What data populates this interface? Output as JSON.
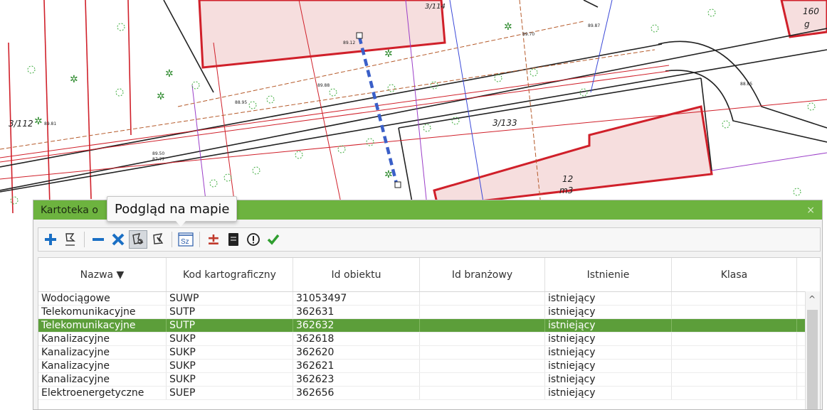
{
  "map": {
    "labels": [
      "3/114",
      "3/112",
      "3/133",
      "12",
      "m3",
      "160",
      "g"
    ],
    "heights": [
      "89.87",
      "89.70",
      "89.88",
      "88.95",
      "89.81",
      "89.50",
      "87.77",
      "89.12",
      "88.85"
    ]
  },
  "panel": {
    "title": "Kartoteka o",
    "close_label": "×"
  },
  "tooltip": {
    "text": "Podgląd na mapie"
  },
  "toolbar": {
    "buttons": [
      {
        "name": "add-icon",
        "color": "#1a6fc4"
      },
      {
        "name": "edit-geometry-icon"
      },
      {
        "name": "remove-icon",
        "color": "#1a6fc4"
      },
      {
        "name": "delete-icon",
        "color": "#1a6fc4"
      },
      {
        "name": "map-preview-icon",
        "active": true
      },
      {
        "name": "map-select-icon"
      },
      {
        "name": "sz-icon",
        "label": "Sz"
      },
      {
        "name": "plus-minus-icon",
        "label": "±",
        "color": "#c0392b"
      },
      {
        "name": "document-icon"
      },
      {
        "name": "warning-icon",
        "label": "!"
      },
      {
        "name": "confirm-icon",
        "color": "#2f9e2f"
      }
    ]
  },
  "grid": {
    "columns": [
      "Nazwa ▼",
      "Kod kartograficzny",
      "Id obiektu",
      "Id branżowy",
      "Istnienie",
      "Klasa"
    ],
    "rows": [
      {
        "nazwa": "Wodociągowe",
        "kod": "SUWP",
        "id": "31053497",
        "idb": "",
        "istnienie": "istniejący",
        "klasa": ""
      },
      {
        "nazwa": "Telekomunikacyjne",
        "kod": "SUTP",
        "id": "362631",
        "idb": "",
        "istnienie": "istniejący",
        "klasa": ""
      },
      {
        "nazwa": "Telekomunikacyjne",
        "kod": "SUTP",
        "id": "362632",
        "idb": "",
        "istnienie": "istniejący",
        "klasa": ""
      },
      {
        "nazwa": "Kanalizacyjne",
        "kod": "SUKP",
        "id": "362618",
        "idb": "",
        "istnienie": "istniejący",
        "klasa": ""
      },
      {
        "nazwa": "Kanalizacyjne",
        "kod": "SUKP",
        "id": "362620",
        "idb": "",
        "istnienie": "istniejący",
        "klasa": ""
      },
      {
        "nazwa": "Kanalizacyjne",
        "kod": "SUKP",
        "id": "362621",
        "idb": "",
        "istnienie": "istniejący",
        "klasa": ""
      },
      {
        "nazwa": "Kanalizacyjne",
        "kod": "SUKP",
        "id": "362623",
        "idb": "",
        "istnienie": "istniejący",
        "klasa": ""
      },
      {
        "nazwa": "Elektroenergetyczne",
        "kod": "SUEP",
        "id": "362656",
        "idb": "",
        "istnienie": "istniejący",
        "klasa": ""
      }
    ],
    "selected_row": 2
  },
  "colors": {
    "titlebar": "#6db33f",
    "selected_row": "#5c9e3a",
    "building_outline": "#d0202a",
    "building_fill": "#f6dede",
    "pipe_line": "#3a5fc8"
  }
}
